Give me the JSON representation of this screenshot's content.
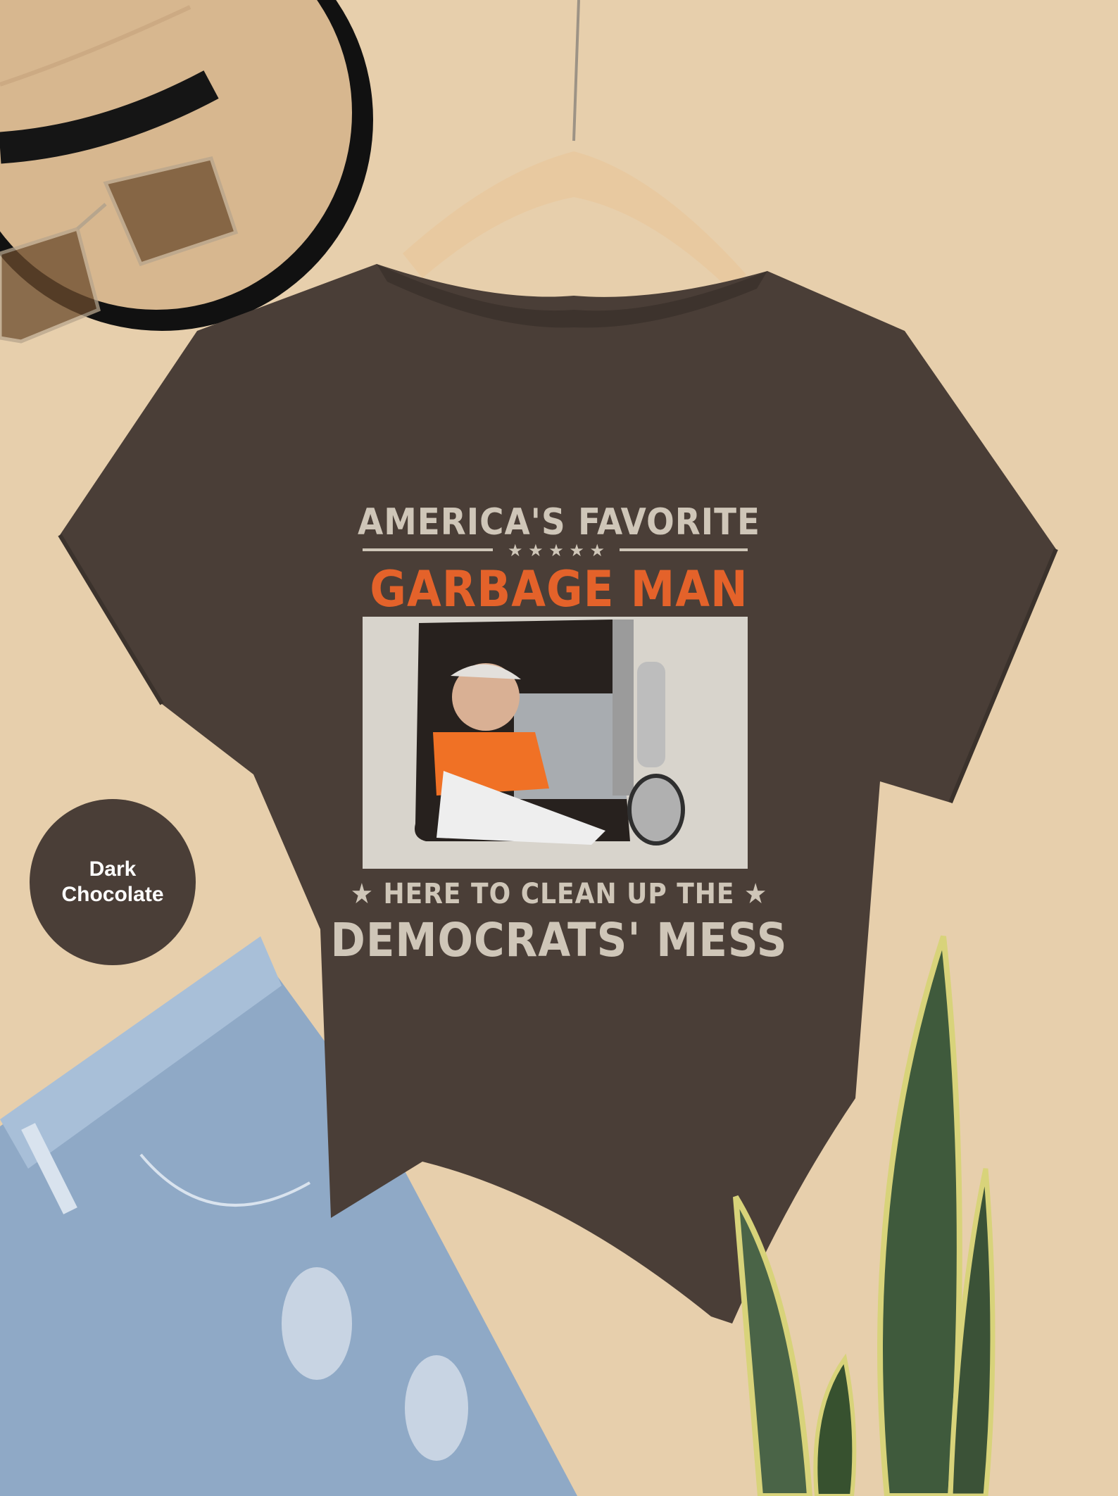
{
  "image": {
    "colors": {
      "wall": "#e7cfac",
      "shirt": "#4a3e37",
      "print_light": "#cfc6b8",
      "print_orange": "#e4622a",
      "denim": "#8fa9c6",
      "hat": "#d7b78f",
      "plant": "#3f5a3c"
    }
  },
  "shirt_print": {
    "line1": "AMERICA'S FAVORITE",
    "line2": "GARBAGE MAN",
    "line3": "★ HERE TO CLEAN UP THE ★",
    "line4": "DEMOCRATS' MESS"
  },
  "color_swatch": {
    "line1": "Dark",
    "line2": "Chocolate"
  }
}
